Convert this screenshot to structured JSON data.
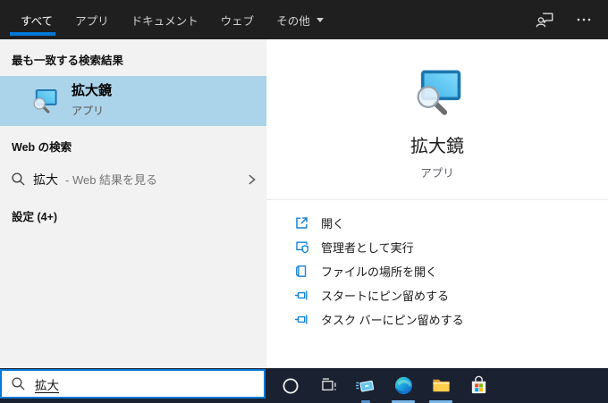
{
  "header": {
    "tabs": [
      {
        "label": "すべて",
        "selected": true
      },
      {
        "label": "アプリ",
        "selected": false
      },
      {
        "label": "ドキュメント",
        "selected": false
      },
      {
        "label": "ウェブ",
        "selected": false
      },
      {
        "label": "その他",
        "selected": false,
        "dropdown": true
      }
    ]
  },
  "left_panel": {
    "best_match_header": "最も一致する検索結果",
    "best_match": {
      "title": "拡大鏡",
      "subtitle": "アプリ"
    },
    "web_header": "Web の検索",
    "web_item": {
      "query": "拡大",
      "suffix": "- Web 結果を見る"
    },
    "settings_header": "設定 (4+)"
  },
  "right_panel": {
    "app_title": "拡大鏡",
    "app_subtitle": "アプリ",
    "actions": [
      {
        "label": "開く",
        "icon": "open-in-new-icon"
      },
      {
        "label": "管理者として実行",
        "icon": "shield-icon"
      },
      {
        "label": "ファイルの場所を開く",
        "icon": "folder-location-icon"
      },
      {
        "label": "スタートにピン留めする",
        "icon": "pin-icon"
      },
      {
        "label": "タスク バーにピン留めする",
        "icon": "pin-icon"
      }
    ]
  },
  "search_box": {
    "value": "拡大"
  },
  "taskbar": {
    "buttons": [
      "cortana",
      "task-view",
      "app-window",
      "microsoft-edge",
      "file-explorer",
      "microsoft-store"
    ]
  },
  "colors": {
    "accent": "#0078d7",
    "highlight_row": "#abd3ea",
    "header_bg": "#1f1f1f",
    "taskbar_bg": "#1a2130",
    "left_panel_bg": "#f2f2f2",
    "action_icon_blue": "#1683d8"
  }
}
